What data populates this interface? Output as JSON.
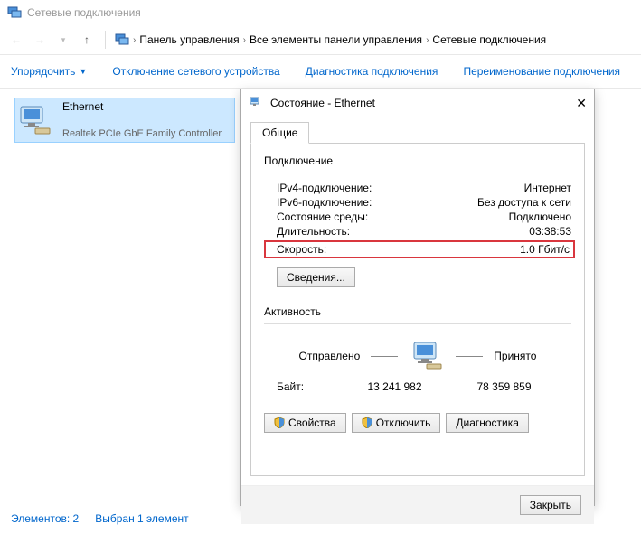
{
  "window": {
    "title": "Сетевые подключения"
  },
  "breadcrumb": {
    "items": [
      "Панель управления",
      "Все элементы панели управления",
      "Сетевые подключения"
    ]
  },
  "toolbar": {
    "organize": "Упорядочить",
    "disable": "Отключение сетевого устройства",
    "diagnose": "Диагностика подключения",
    "rename": "Переименование подключения"
  },
  "network": {
    "name": "Ethernet",
    "desc": "Realtek PCIe GbE Family Controller"
  },
  "statusbar": {
    "items_count": "Элементов: 2",
    "selected": "Выбран 1 элемент"
  },
  "dialog": {
    "title": "Состояние - Ethernet",
    "tab": "Общие",
    "connection_label": "Подключение",
    "rows": {
      "ipv4_label": "IPv4-подключение:",
      "ipv4_value": "Интернет",
      "ipv6_label": "IPv6-подключение:",
      "ipv6_value": "Без доступа к сети",
      "media_label": "Состояние среды:",
      "media_value": "Подключено",
      "duration_label": "Длительность:",
      "duration_value": "03:38:53",
      "speed_label": "Скорость:",
      "speed_value": "1.0 Гбит/с"
    },
    "details_btn": "Сведения...",
    "activity_label": "Активность",
    "sent_label": "Отправлено",
    "recv_label": "Принято",
    "bytes_label": "Байт:",
    "sent_bytes": "13 241 982",
    "recv_bytes": "78 359 859",
    "properties_btn": "Свойства",
    "disable_btn": "Отключить",
    "diagnose_btn": "Диагностика",
    "close_btn": "Закрыть"
  }
}
